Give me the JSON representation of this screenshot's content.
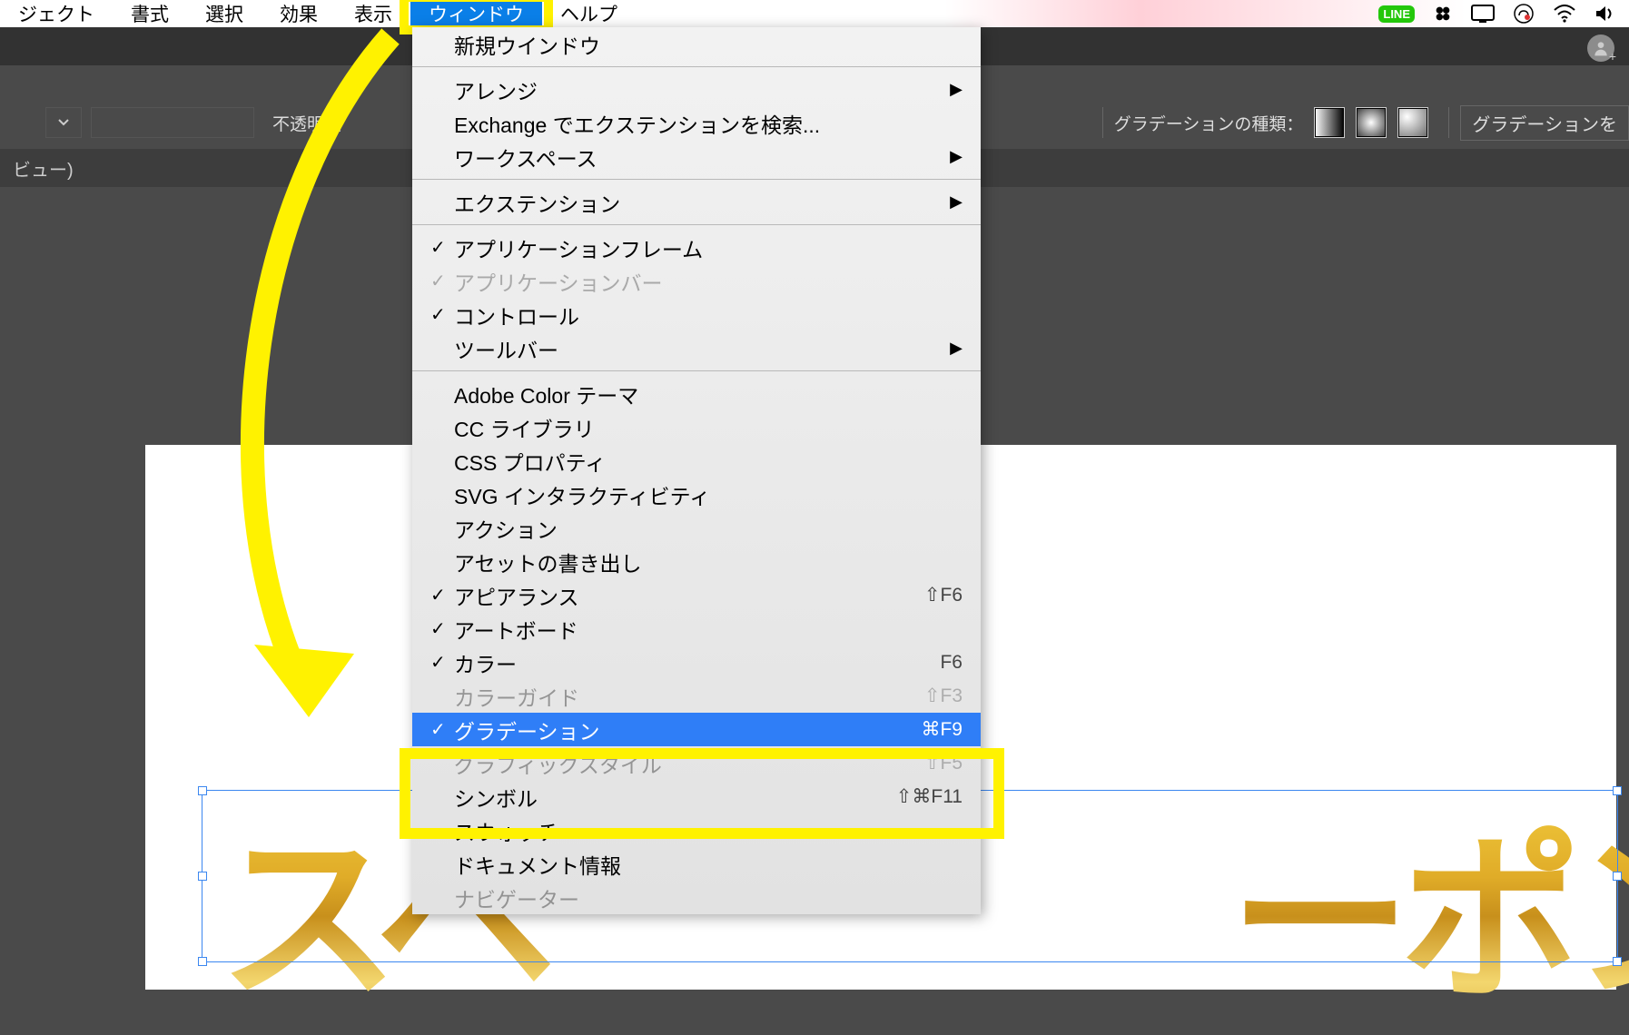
{
  "menubar": {
    "items": [
      "ジェクト",
      "書式",
      "選択",
      "効果",
      "表示"
    ],
    "window_label": "ウィンドウ",
    "help_label": "ヘルプ"
  },
  "options_bar": {
    "opacity_label": "不透明度",
    "gradient_type_label": "グラデーションの種類：",
    "gradient_edit_label": "グラデーションを"
  },
  "tab": {
    "label": "ビュー)"
  },
  "canvas": {
    "gold_text": "スペ　　　　ーポン"
  },
  "dropdown": {
    "items": [
      {
        "label": "新規ウインドウ"
      },
      {
        "sep": true
      },
      {
        "label": "アレンジ",
        "sub": true
      },
      {
        "label": "Exchange でエクステンションを検索..."
      },
      {
        "label": "ワークスペース",
        "sub": true
      },
      {
        "sep": true
      },
      {
        "label": "エクステンション",
        "sub": true
      },
      {
        "sep": true
      },
      {
        "label": "アプリケーションフレーム",
        "check": true
      },
      {
        "label": "アプリケーションバー",
        "check": true,
        "disabled": true
      },
      {
        "label": "コントロール",
        "check": true
      },
      {
        "label": "ツールバー",
        "sub": true
      },
      {
        "sep": true
      },
      {
        "label": "Adobe Color テーマ"
      },
      {
        "label": "CC ライブラリ"
      },
      {
        "label": "CSS プロパティ"
      },
      {
        "label": "SVG インタラクティビティ"
      },
      {
        "label": "アクション"
      },
      {
        "label": "アセットの書き出し"
      },
      {
        "label": "アピアランス",
        "check": true,
        "shortcut": "⇧F6"
      },
      {
        "label": "アートボード",
        "check": true
      },
      {
        "label": "カラー",
        "check": true,
        "shortcut": "F6"
      },
      {
        "label": "カラーガイド",
        "shortcut": "⇧F3",
        "obscured": true
      },
      {
        "label": "グラデーション",
        "check": true,
        "shortcut": "⌘F9",
        "highlight": true
      },
      {
        "label": "グラフィックスタイル",
        "shortcut": "⇧F5",
        "obscured": true
      },
      {
        "label": "シンボル",
        "shortcut": "⇧⌘F11"
      },
      {
        "label": "スウォッチ"
      },
      {
        "label": "ドキュメント情報"
      },
      {
        "label": "ナビゲーター",
        "obscured": true
      }
    ]
  },
  "tray": {
    "line": "LINE"
  },
  "colors": {
    "highlight_yellow": "#fff200",
    "menu_blue": "#2f7ef7"
  }
}
